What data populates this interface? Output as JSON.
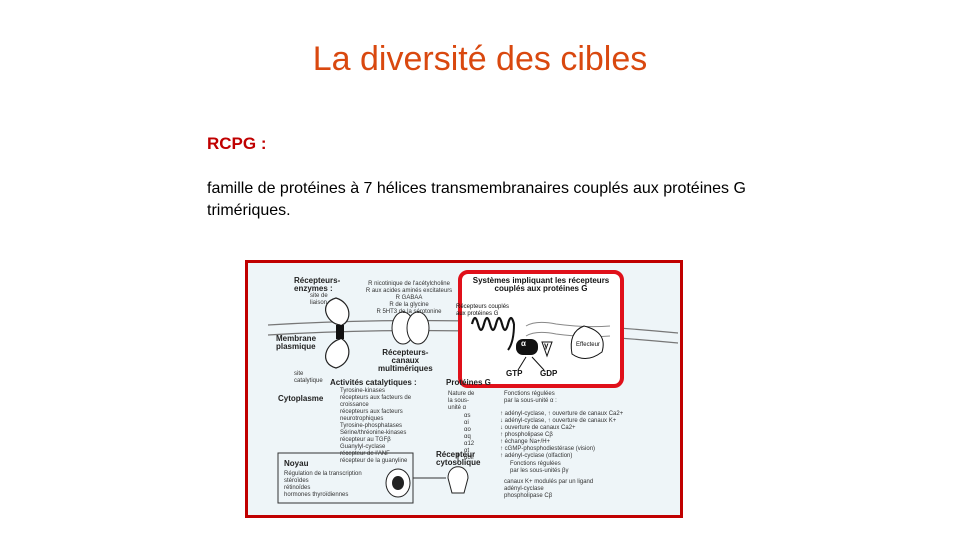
{
  "slide": {
    "title": "La diversité des cibles",
    "heading": "RCPG :",
    "body": "famille de protéines à 7 hélices transmembranaires couplés aux protéines G trimériques."
  },
  "figure": {
    "enzyme_receptors": "Récepteurs-\nenzymes :",
    "binding_site": "site de\nliaison",
    "membrane": "Membrane\nplasmique",
    "catalytic_site": "site\ncatalytique",
    "cytoplasm": "Cytoplasme",
    "nucleus": "Noyau",
    "channel_receptors": "Récepteurs-\ncanaux\nmultimériques",
    "channel_list": "R nicotinique de l'acétylcholine\nR aux acides aminés excitateurs\nR GABAA\nR de la glycine\nR 5HT3 de la sérotonine",
    "catalytic_title": "Activités catalytiques :",
    "catalytic_list": "Tyrosine-kinases\nrécepteurs aux facteurs de\ncroissance\nrécepteurs aux facteurs\nneurotrophiques\nTyrosine-phosphatases\nSérine/thréonine-kinases\nrécepteur au TGFβ\nGuanylyl-cyclase\nrécepteur de l'ANF\nrécepteur de la guanyline",
    "nuclear_list": "Régulation de la transcription\nstéroïdes\nrétinoïdes\nhormones thyroïdiennes",
    "cytosolic_receptor": "Récepteur\ncytosolique",
    "gpcr_box_title": "Systèmes impliquant les récepteurs\ncouplés aux protéines G",
    "gpcr_label": "Récepteurs couplés\naux protéines G",
    "alpha": "α",
    "gamma": "γ",
    "gtp": "GTP",
    "gdp": "GDP",
    "effector": "Effecteur",
    "g_proteins_label": "Protéines G",
    "alpha_nature": "Nature de\nla sous-\nunité α",
    "alpha_list": "αs\nαi\nαo\nαq\nα12\nαt\nαolf",
    "alpha_functions_title": "Fonctions régulées\npar la sous-unité α :",
    "alpha_functions": "↑ adényl-cyclase, ↑ ouverture de canaux Ca2+\n↓ adényl-cyclase, ↑ ouverture de canaux K+\n↓ ouverture de canaux Ca2+\n↑ phospholipase Cβ\n↑ échange Na+/H+\n↑ cGMP-phosphodiestérase (vision)\n↑ adényl-cyclase (olfaction)",
    "bg_functions_title": "Fonctions régulées\npar les sous-unités βγ",
    "bg_functions": "canaux K+ modulés par un ligand\nadényl-cyclase\nphospholipase Cβ"
  }
}
